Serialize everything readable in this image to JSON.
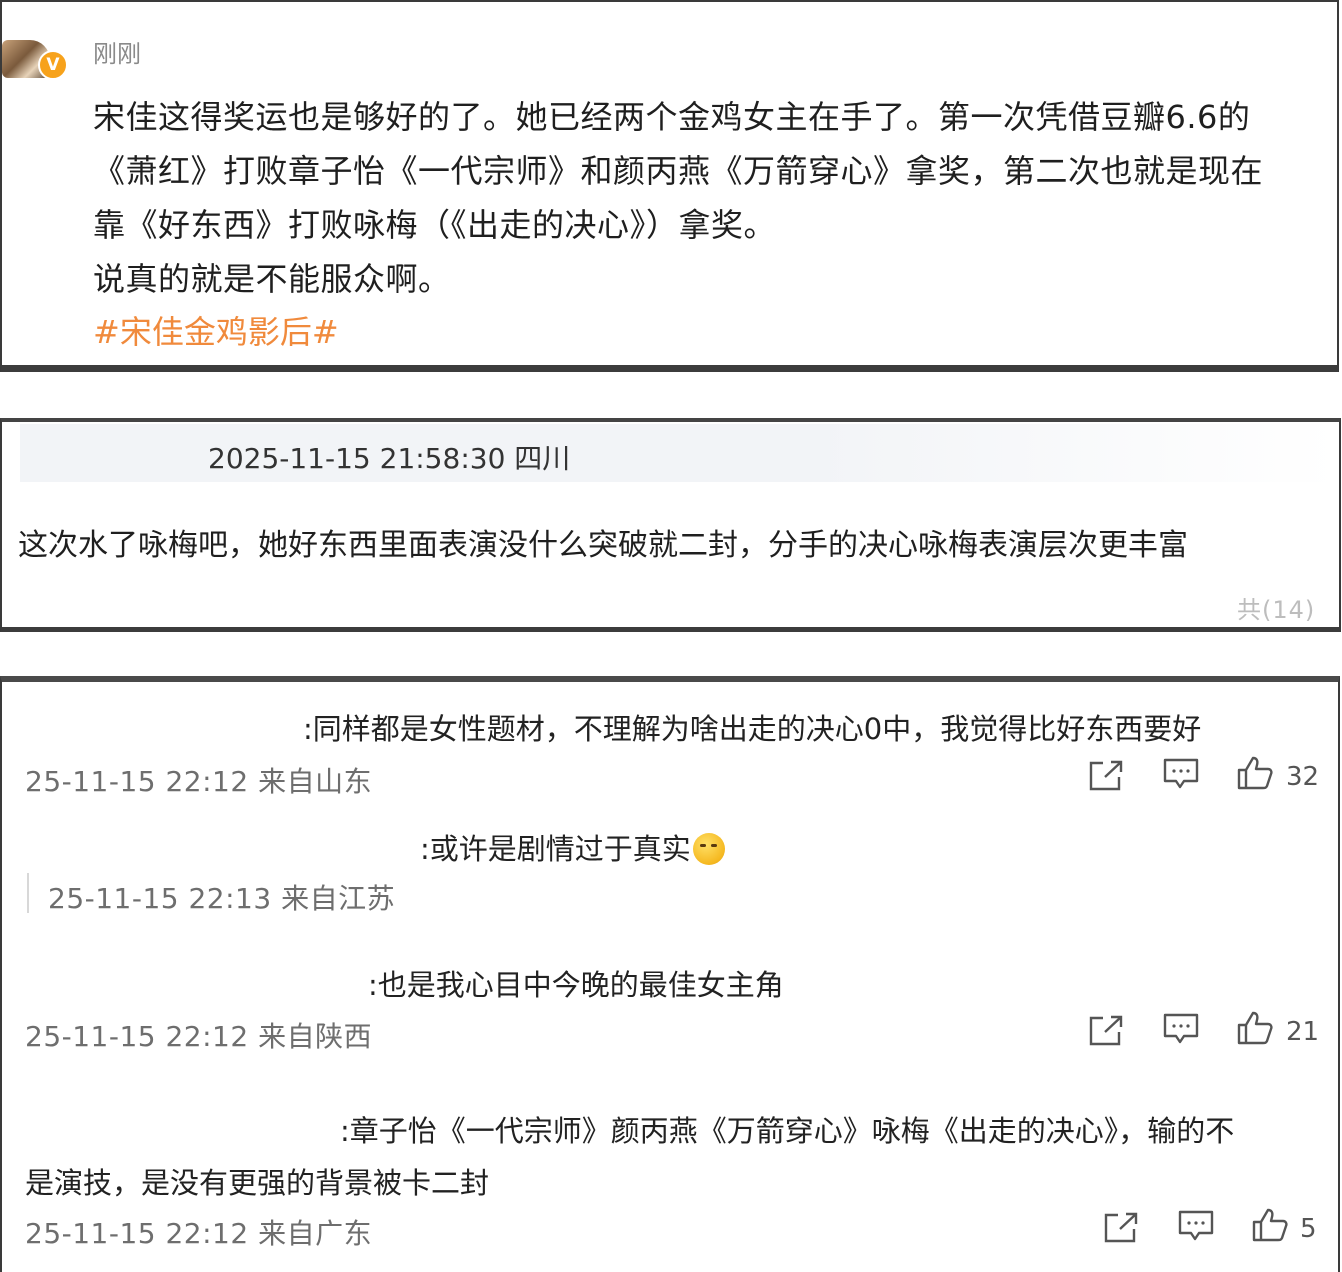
{
  "post": {
    "time": "刚刚",
    "verified_badge": "V",
    "lines": [
      "宋佳这得奖运也是够好的了。她已经两个金鸡女主在手了。第一次凭借豆瓣6.6的",
      "《萧红》打败章子怡《一代宗师》和颜丙燕《万箭穿心》拿奖，第二次也就是现在",
      "靠《好东西》打败咏梅（《出走的决心》）拿奖。",
      "说真的就是不能服众啊。"
    ],
    "hashtag": "#宋佳金鸡影后#",
    "hashtag_color": "#f08a3c"
  },
  "comment": {
    "meta": "2025-11-15 21:58:30 四川",
    "text": "这次水了咏梅吧，她好东西里面表演没什么突破就二封，分手的决心咏梅表演层次更丰富",
    "more": "共(14)"
  },
  "replies": [
    {
      "text": ":同样都是女性题材，不理解为啥出走的决心0中，我觉得比好东西要好",
      "meta": "25-11-15 22:12 来自山东",
      "likes": "32"
    },
    {
      "text": ":或许是剧情过于真实",
      "emoji": "smirk-emoji",
      "meta": "25-11-15 22:13 来自江苏"
    },
    {
      "text": ":也是我心目中今晚的最佳女主角",
      "meta": "25-11-15 22:12 来自陕西",
      "likes": "21"
    },
    {
      "text_line1": ":章子怡《一代宗师》颜丙燕《万箭穿心》咏梅《出走的决心》，输的不",
      "text_line2": "是演技，是没有更强的背景被卡二封",
      "meta": "25-11-15 22:12 来自广东",
      "likes": "5"
    }
  ],
  "icons": {
    "share": "share-icon",
    "comment": "comment-icon",
    "like": "thumbs-up-icon"
  }
}
